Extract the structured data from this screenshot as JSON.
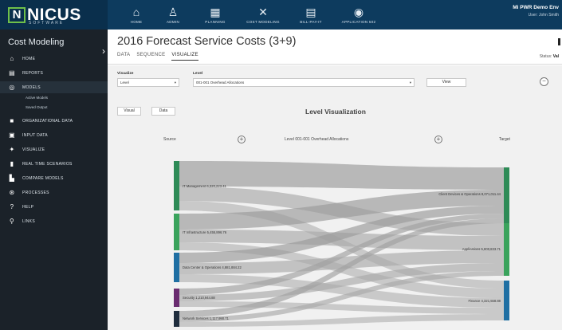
{
  "brand": {
    "mark": "N",
    "word": "NICUS",
    "sub": "SOFTWARE"
  },
  "nav": [
    {
      "label": "HOME",
      "glyph": "⌂"
    },
    {
      "label": "ADMIN",
      "glyph": "♙"
    },
    {
      "label": "PLANNING",
      "glyph": "▦"
    },
    {
      "label": "COST MODELING",
      "glyph": "✕"
    },
    {
      "label": "BILL-PAY-IT",
      "glyph": "▤"
    },
    {
      "label": "APPLICATION 502",
      "glyph": "◉"
    }
  ],
  "user": {
    "org": "Mi PWR Demo Env",
    "name": "User: John Smith"
  },
  "sidebar": {
    "title": "Cost Modeling",
    "items": [
      {
        "label": "HOME",
        "glyph": "⌂"
      },
      {
        "label": "REPORTS",
        "glyph": "▤"
      },
      {
        "label": "MODELS",
        "glyph": "◎"
      },
      {
        "label": "ORGANIZATIONAL DATA",
        "glyph": "■"
      },
      {
        "label": "INPUT DATA",
        "glyph": "▣"
      },
      {
        "label": "VISUALIZE",
        "glyph": "✦"
      },
      {
        "label": "REAL TIME SCENARIOS",
        "glyph": "▮"
      },
      {
        "label": "COMPARE MODELS",
        "glyph": "▙"
      },
      {
        "label": "PROCESSES",
        "glyph": "⊛"
      },
      {
        "label": "HELP",
        "glyph": "?"
      },
      {
        "label": "LINKS",
        "glyph": "⚲"
      }
    ],
    "subitems": [
      "Active Models",
      "Saved Output"
    ]
  },
  "page": {
    "title": "2016 Forecast Service Costs (3+9)",
    "tabs": [
      "DATA",
      "SEQUENCE",
      "VISUALIZE"
    ],
    "status_label": "Status:",
    "status_value": "Val"
  },
  "controls": {
    "visualize_label": "Visualize",
    "visualize_value": "Level",
    "level_label": "Level",
    "level_value": "001-001 Overhead Allocations",
    "view_button": "View",
    "visual_button": "Visual",
    "data_button": "Data",
    "minus_glyph": "−",
    "plus_glyph": "+"
  },
  "viz": {
    "title": "Level Visualization",
    "col_source": "Source",
    "col_level": "Level 001-001 Overhead Allocations",
    "col_target": "Target"
  },
  "sankey": {
    "sources": [
      {
        "label": "IT Management 6,320,223.41",
        "color": "#2e8b57"
      },
      {
        "label": "IT Infrastructure 5,455,896.76",
        "color": "#3aa35c"
      },
      {
        "label": "Data Center & Operations 4,881,884.22",
        "color": "#1f6fa3"
      },
      {
        "label": "Security 1,210,944.88",
        "color": "#6a2c70"
      },
      {
        "label": "Network Services 1,117,990.71",
        "color": "#1f2d3d"
      }
    ],
    "targets": [
      {
        "label": "Client Devices & Operations 8,071,011.44",
        "color": "#2e8b57"
      },
      {
        "label": "Applications 5,800,833.71",
        "color": "#3aa35c"
      },
      {
        "label": "Finance 4,321,558.88",
        "color": "#1f6fa3"
      }
    ]
  },
  "colors": {
    "topbar": "#0d3b5e",
    "sidebar": "#1b2229",
    "link": "#9a9a9a"
  }
}
